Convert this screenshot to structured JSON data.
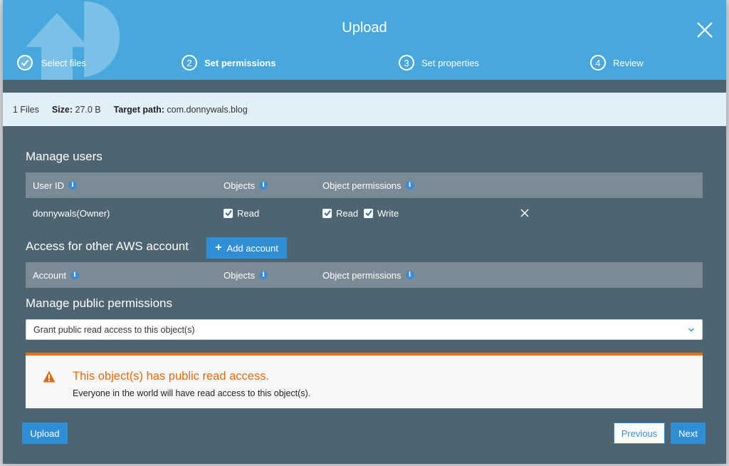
{
  "header": {
    "title": "Upload",
    "steps": [
      {
        "number": "",
        "label": "Select files",
        "state": "complete"
      },
      {
        "number": "2",
        "label": "Set permissions",
        "state": "active"
      },
      {
        "number": "3",
        "label": "Set properties",
        "state": "pending"
      },
      {
        "number": "4",
        "label": "Review",
        "state": "pending"
      }
    ]
  },
  "infobar": {
    "files": "1 Files",
    "size_label": "Size:",
    "size_value": "27.0 B",
    "path_label": "Target path:",
    "path_value": "com.donnywals.blog"
  },
  "manage_users": {
    "title": "Manage users",
    "columns": {
      "user_id": "User ID",
      "objects": "Objects",
      "object_permissions": "Object permissions"
    },
    "rows": [
      {
        "user": "donnywals(Owner)",
        "objects_read": "Read",
        "perm_read": "Read",
        "perm_write": "Write"
      }
    ]
  },
  "other_accounts": {
    "title": "Access for other AWS account",
    "add_button": "Add account",
    "columns": {
      "account": "Account",
      "objects": "Objects",
      "object_permissions": "Object permissions"
    }
  },
  "public_permissions": {
    "title": "Manage public permissions",
    "selected": "Grant public read access to this object(s)"
  },
  "alert": {
    "title": "This object(s) has public read access.",
    "text": "Everyone in the world will have read access to this object(s)."
  },
  "footer": {
    "upload": "Upload",
    "previous": "Previous",
    "next": "Next"
  },
  "colors": {
    "header_bg": "#48a8dd",
    "modal_bg": "#4f6471",
    "primary": "#2f8ed6",
    "warning": "#ec7211"
  }
}
